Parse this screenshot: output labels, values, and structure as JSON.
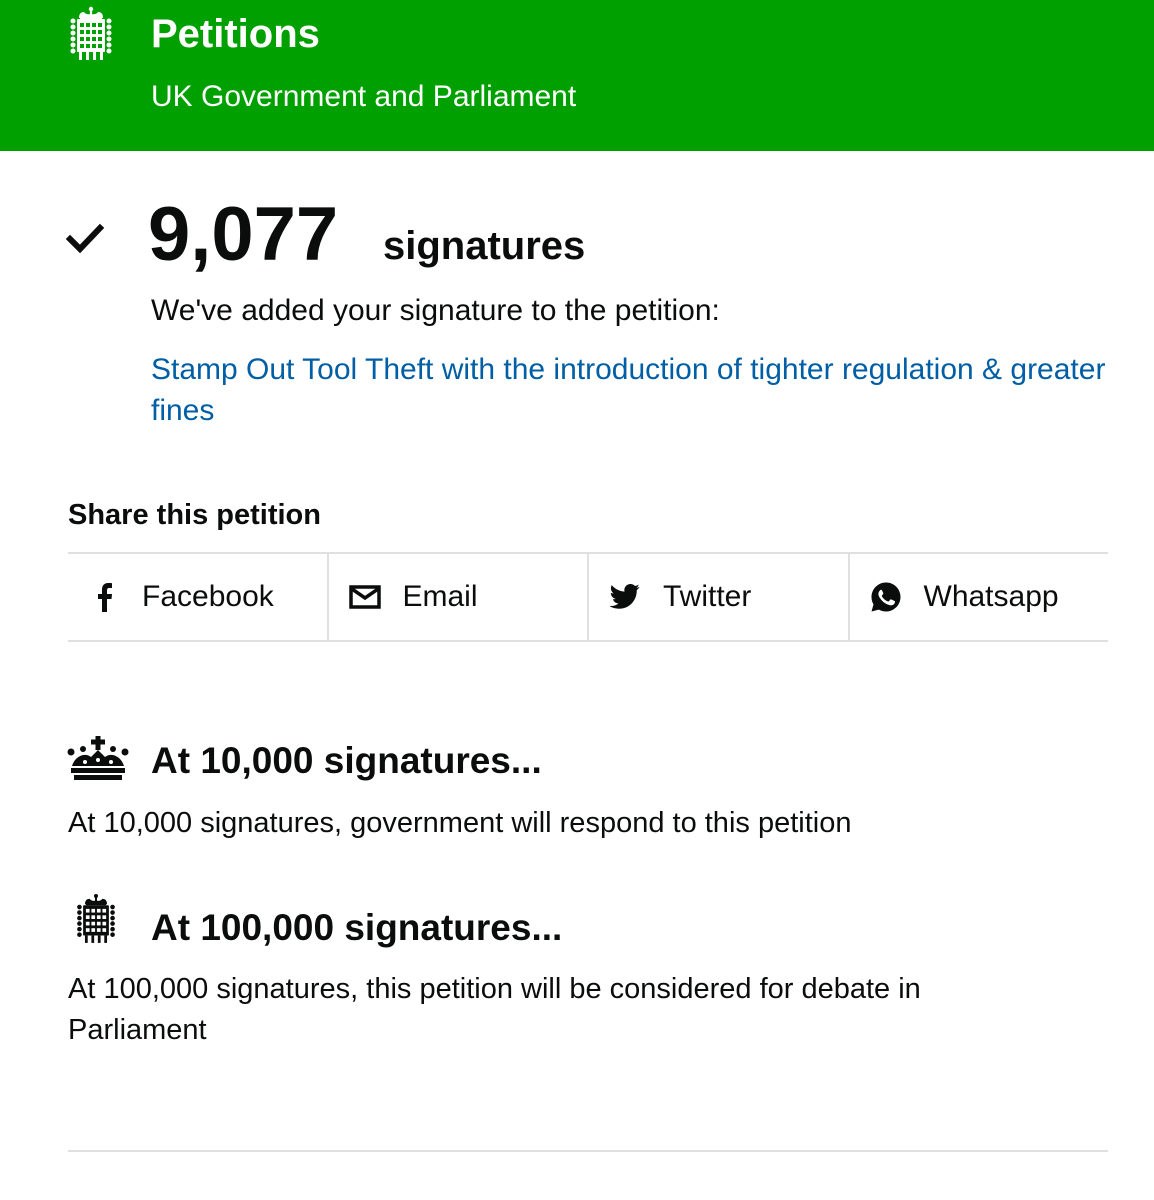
{
  "header": {
    "title": "Petitions",
    "subtitle": "UK Government and Parliament",
    "background_color": "#00a000",
    "logo_icon": "portcullis-icon"
  },
  "signature": {
    "count": "9,077",
    "label": "signatures",
    "confirmation": "We've added your signature to the petition:",
    "petition_title": "Stamp Out Tool Theft with the introduction of tighter regulation & greater fines",
    "link_color": "#005ea5",
    "status_icon": "checkmark-icon"
  },
  "share": {
    "heading": "Share this petition",
    "buttons": [
      {
        "label": "Facebook",
        "icon": "facebook-icon"
      },
      {
        "label": "Email",
        "icon": "envelope-icon"
      },
      {
        "label": "Twitter",
        "icon": "twitter-icon"
      },
      {
        "label": "Whatsapp",
        "icon": "whatsapp-icon"
      }
    ]
  },
  "thresholds": [
    {
      "heading": "At 10,000 signatures...",
      "body": "At 10,000 signatures, government will respond to this petition",
      "icon": "crown-icon"
    },
    {
      "heading": "At 100,000 signatures...",
      "body": "At 100,000 signatures, this petition will be considered for debate in Parliament",
      "icon": "portcullis-icon"
    }
  ]
}
